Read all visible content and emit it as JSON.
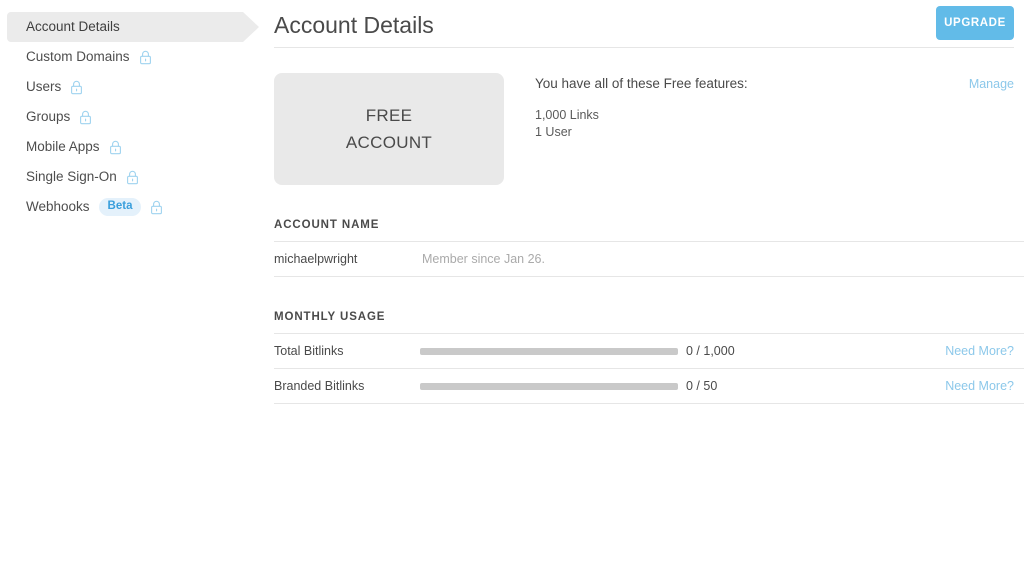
{
  "sidebar": {
    "items": [
      {
        "label": "Account Details",
        "active": true,
        "locked": false,
        "badge": null
      },
      {
        "label": "Custom Domains",
        "active": false,
        "locked": true,
        "badge": null
      },
      {
        "label": "Users",
        "active": false,
        "locked": true,
        "badge": null
      },
      {
        "label": "Groups",
        "active": false,
        "locked": true,
        "badge": null
      },
      {
        "label": "Mobile Apps",
        "active": false,
        "locked": true,
        "badge": null
      },
      {
        "label": "Single Sign-On",
        "active": false,
        "locked": true,
        "badge": null
      },
      {
        "label": "Webhooks",
        "active": false,
        "locked": true,
        "badge": "Beta"
      }
    ],
    "lock_icon": "lock-icon"
  },
  "header": {
    "title": "Account Details",
    "upgrade_label": "UPGRADE"
  },
  "plan": {
    "card_line1": "FREE",
    "card_line2": "ACCOUNT",
    "features_heading": "You have all of these Free features:",
    "features": [
      "1,000 Links",
      "1 User"
    ],
    "manage_label": "Manage"
  },
  "account_name": {
    "section_title": "ACCOUNT NAME",
    "username": "michaelpwright",
    "member_since": "Member since Jan 26."
  },
  "monthly_usage": {
    "section_title": "MONTHLY USAGE",
    "need_more_label": "Need More?",
    "rows": [
      {
        "name": "Total Bitlinks",
        "count": "0 / 1,000",
        "used": 0,
        "limit": 1000,
        "percent": 0
      },
      {
        "name": "Branded Bitlinks",
        "count": "0 / 50",
        "used": 0,
        "limit": 50,
        "percent": 0
      }
    ]
  },
  "colors": {
    "accent": "#62bbe8",
    "link": "#8cc8ea",
    "badge_bg": "#e4f1fb",
    "badge_text": "#3a9fdc",
    "card_bg": "#e9e9e9",
    "active_nav_bg": "#ebebeb",
    "bar_track": "#c9c9c9",
    "divider": "#e6e6e6"
  }
}
